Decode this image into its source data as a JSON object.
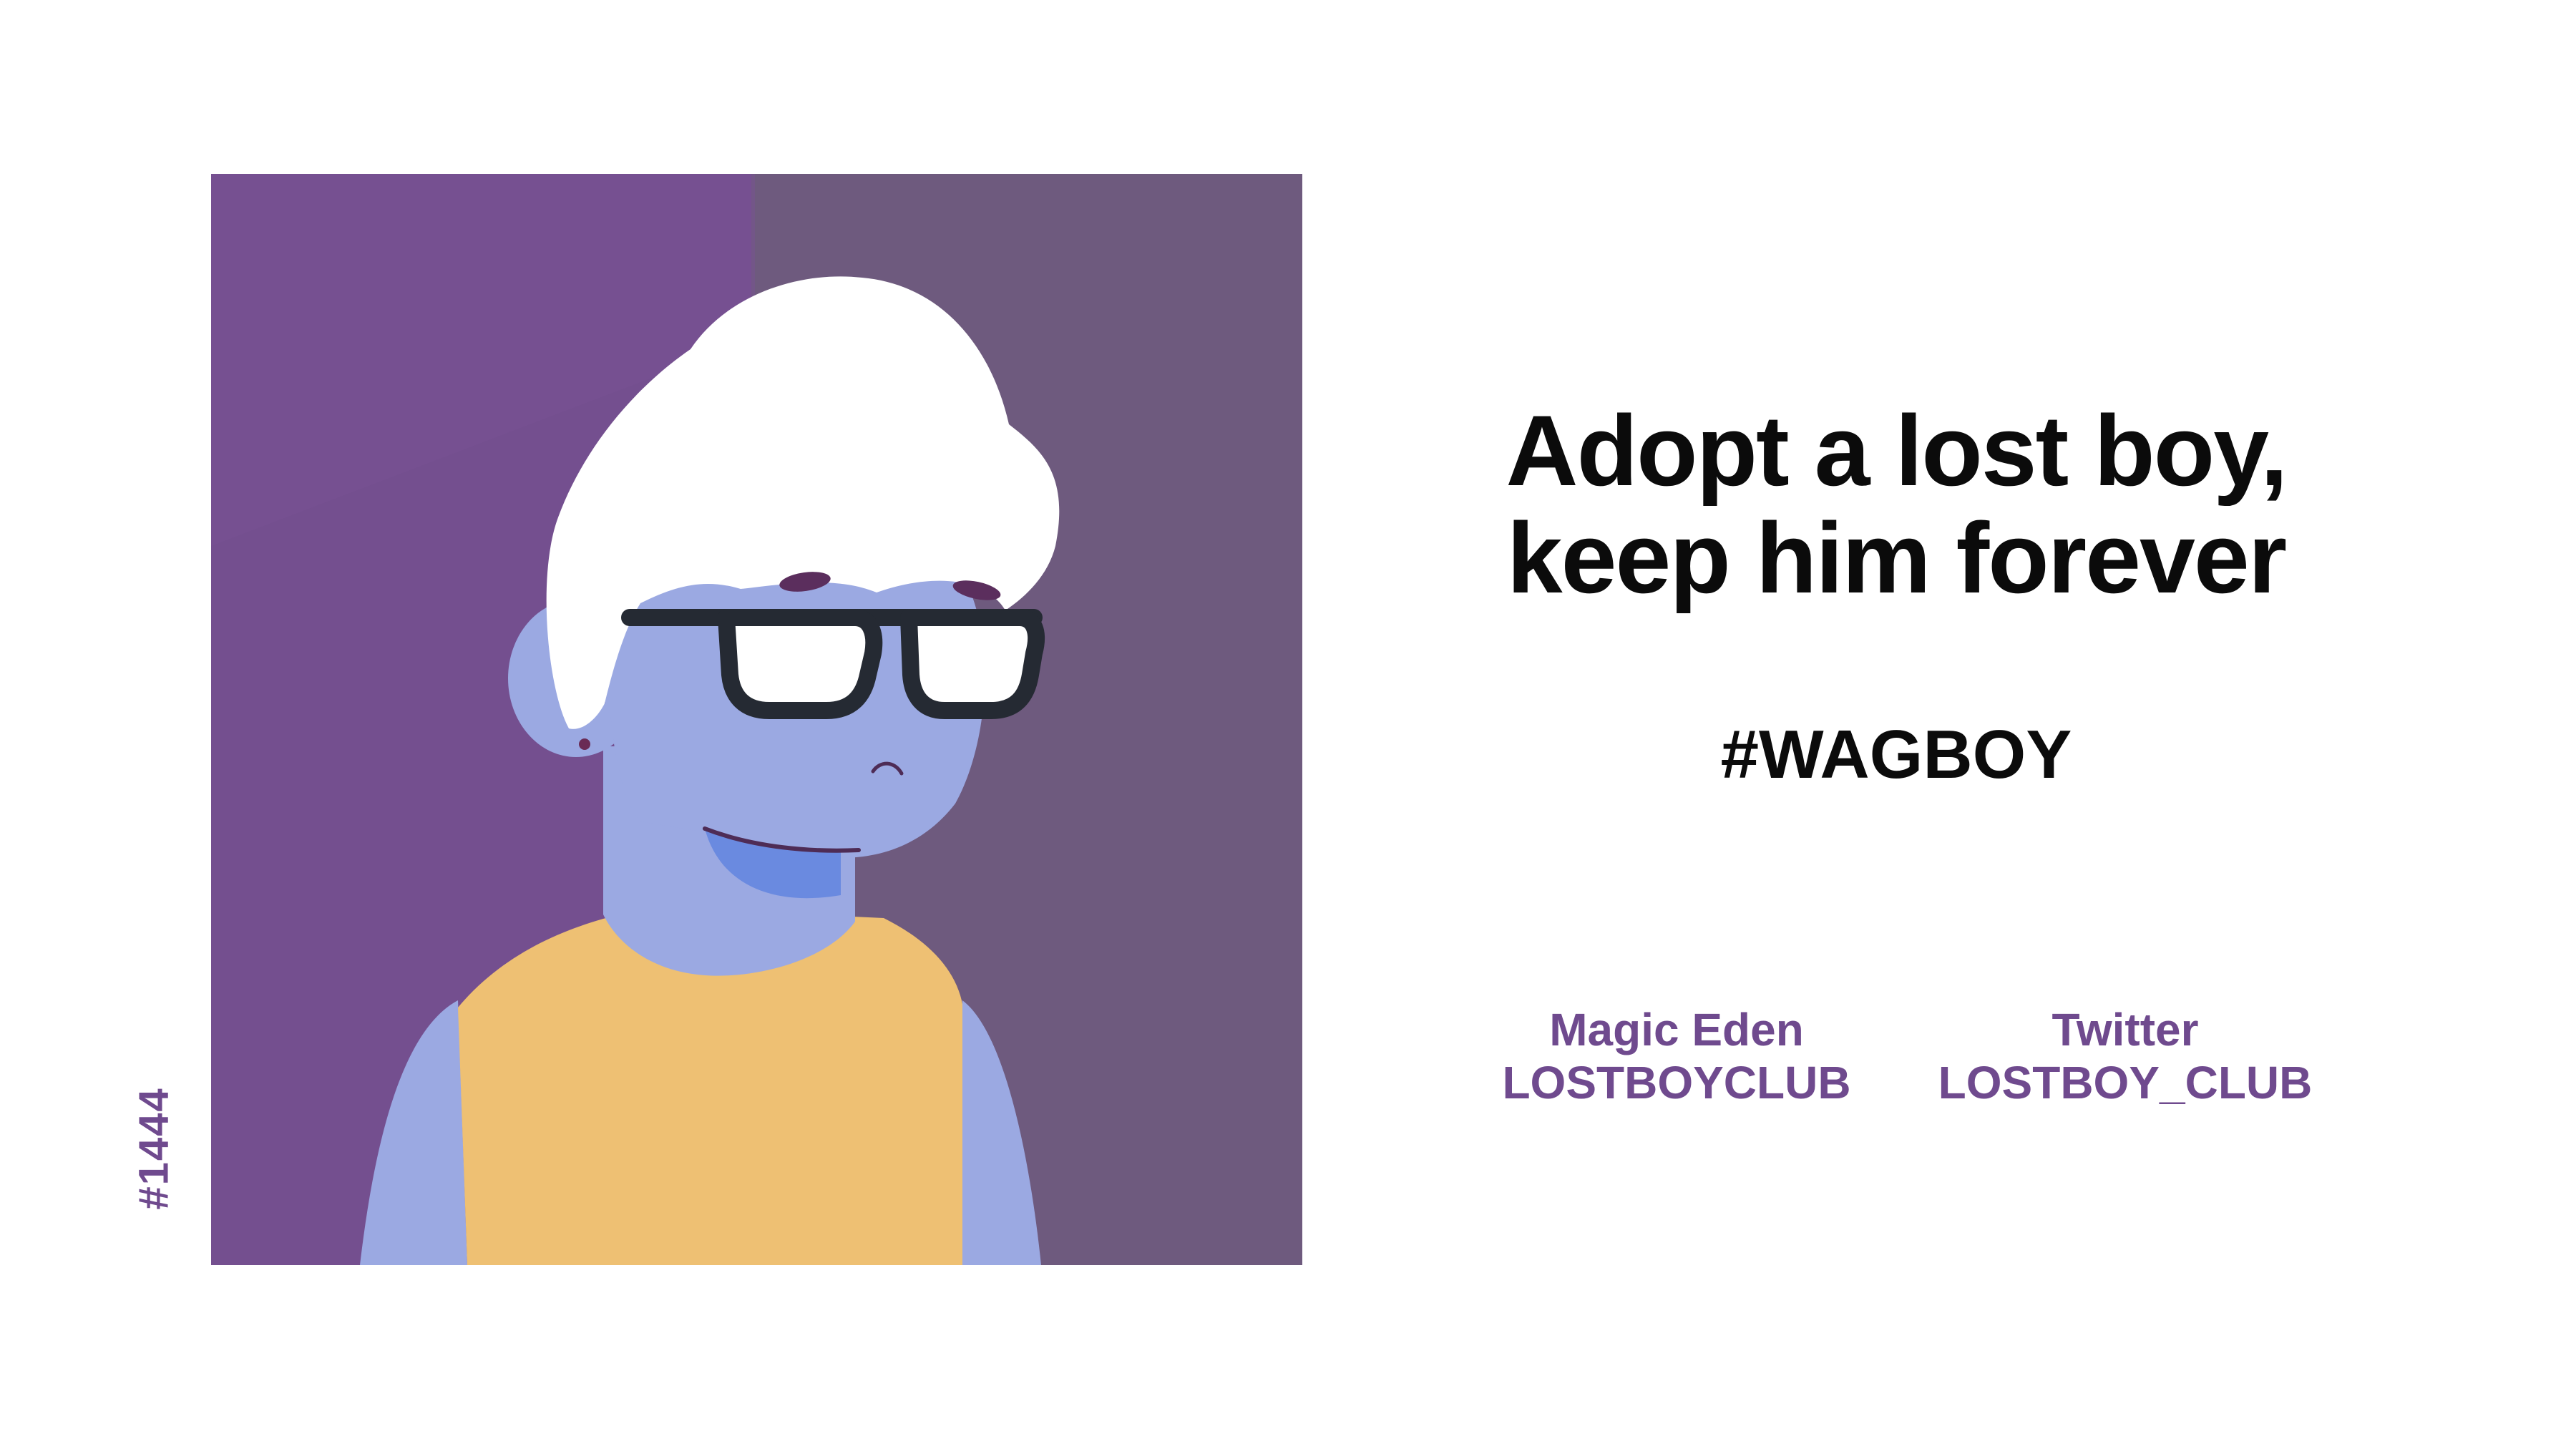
{
  "token_id": "#1444",
  "headline": {
    "line1": "Adopt a lost boy,",
    "line2": "keep him forever"
  },
  "hashtag": "#WAGBOY",
  "links": {
    "magic_eden": {
      "label": "Magic Eden",
      "handle": "LOSTBOYCLUB"
    },
    "twitter": {
      "label": "Twitter",
      "handle": "LOSTBOY_CLUB"
    }
  },
  "colors": {
    "accent_purple": "#6f4a8e",
    "background_left": "#744f8f",
    "background_right": "#6e5a7e",
    "skin": "#9ba9e2",
    "shirt": "#eec073",
    "hair": "#ffffff",
    "glasses": "#252a33"
  }
}
